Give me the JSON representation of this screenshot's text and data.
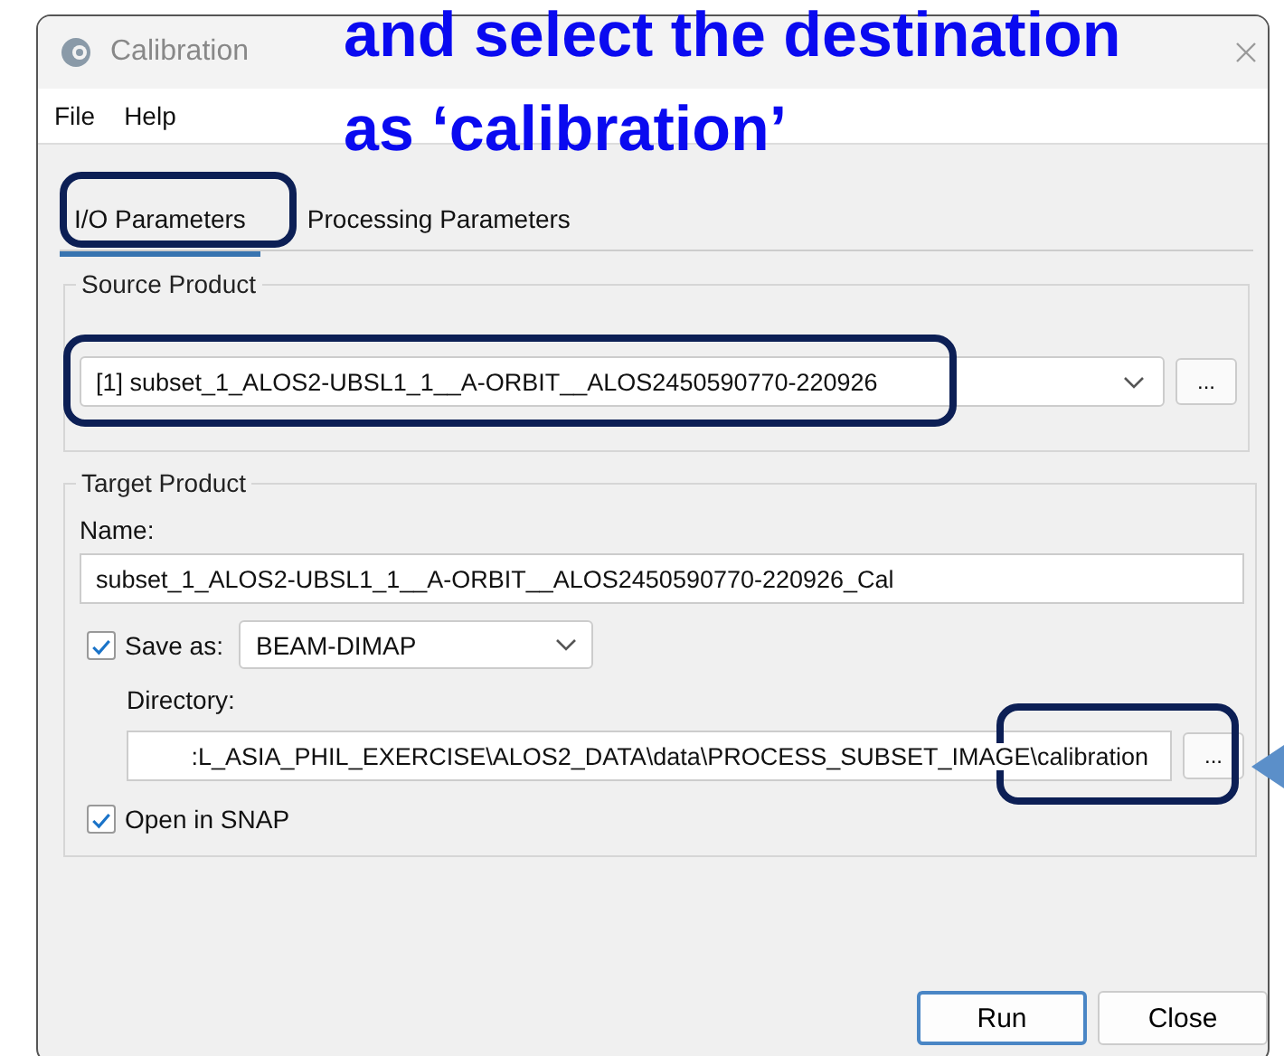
{
  "window": {
    "title": "Calibration"
  },
  "menu": [
    "File",
    "Help"
  ],
  "tabs": [
    {
      "label": "I/O Parameters",
      "selected": true
    },
    {
      "label": "Processing Parameters",
      "selected": false
    }
  ],
  "source_product": {
    "title": "Source Product",
    "value": "[1] subset_1_ALOS2-UBSL1_1__A-ORBIT__ALOS2450590770-220926",
    "browse": "..."
  },
  "target_product": {
    "title": "Target Product",
    "name_label": "Name:",
    "name": "subset_1_ALOS2-UBSL1_1__A-ORBIT__ALOS2450590770-220926_Cal",
    "save_as": {
      "label": "Save as:",
      "checked": true,
      "format": "BEAM-DIMAP"
    },
    "directory_label": "Directory:",
    "directory": ":L_ASIA_PHIL_EXERCISE\\ALOS2_DATA\\data\\PROCESS_SUBSET_IMAGE\\calibration",
    "browse": "...",
    "open_in_snap": {
      "label": "Open in SNAP",
      "checked": true
    }
  },
  "buttons": [
    {
      "label": "Run",
      "kind": "default"
    },
    {
      "label": "Close",
      "kind": "normal"
    }
  ],
  "annotation": {
    "lines": [
      "and select the destination",
      "as ‘calibration’"
    ]
  }
}
